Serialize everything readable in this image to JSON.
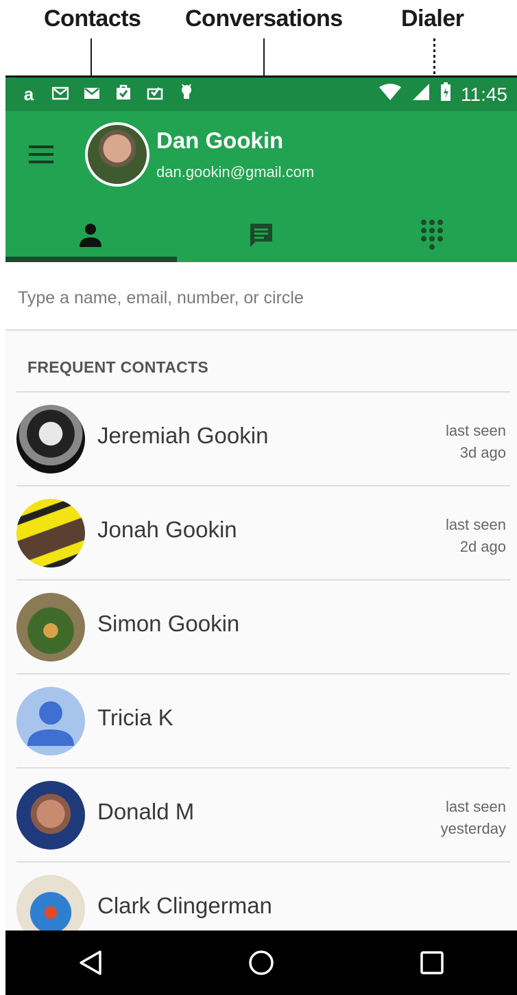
{
  "callouts": {
    "contacts": "Contacts",
    "conversations": "Conversations",
    "dialer": "Dialer"
  },
  "status_bar": {
    "time": "11:45",
    "left_icons": [
      "amazon-icon",
      "gmail-icon",
      "mail-icon",
      "shopping-bag-icon",
      "inbox-check-icon",
      "android-icon"
    ],
    "right_icons": [
      "wifi-icon",
      "signal-icon",
      "battery-charging-icon"
    ]
  },
  "app_bar": {
    "user_name": "Dan Gookin",
    "user_email": "dan.gookin@gmail.com",
    "color": "#21a351",
    "tabs": [
      {
        "id": "contacts",
        "icon": "person-icon",
        "selected": true
      },
      {
        "id": "conversations",
        "icon": "chat-icon",
        "selected": false
      },
      {
        "id": "dialer",
        "icon": "dialpad-icon",
        "selected": false
      }
    ]
  },
  "search": {
    "placeholder": "Type a name, email, number, or circle",
    "value": ""
  },
  "frequent": {
    "header": "FREQUENT CONTACTS",
    "contacts": [
      {
        "name": "Jeremiah Gookin",
        "seen_line1": "last seen",
        "seen_line2": "3d ago"
      },
      {
        "name": "Jonah Gookin",
        "seen_line1": "last seen",
        "seen_line2": "2d ago"
      },
      {
        "name": "Simon Gookin",
        "seen_line1": "",
        "seen_line2": ""
      },
      {
        "name": "Tricia K",
        "seen_line1": "",
        "seen_line2": ""
      },
      {
        "name": "Donald M",
        "seen_line1": "last seen",
        "seen_line2": "yesterday"
      },
      {
        "name": "Clark Clingerman",
        "seen_line1": "",
        "seen_line2": ""
      }
    ]
  },
  "nav_bar": {
    "buttons": [
      "back-icon",
      "home-icon",
      "recents-icon"
    ]
  }
}
